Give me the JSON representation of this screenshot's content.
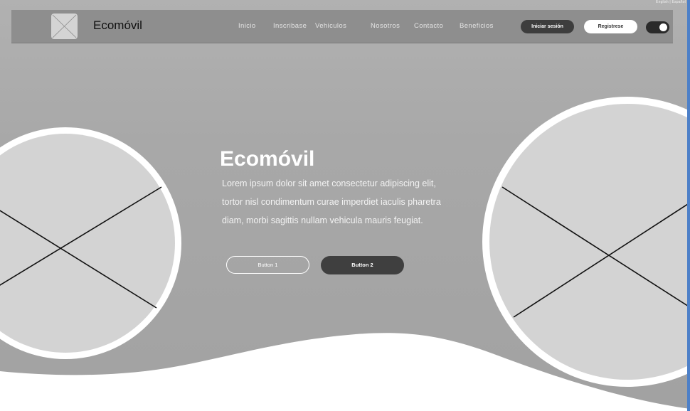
{
  "lang_switch": "English | Español",
  "navbar": {
    "brand": "Ecomóvil",
    "links": [
      "Inicio",
      "Inscribase",
      "Vehiculos",
      "Nosotros",
      "Contacto",
      "Beneficios"
    ],
    "login_label": "Iniciar sesión",
    "register_label": "Registrese"
  },
  "hero": {
    "title": "Ecomóvil",
    "text": "Lorem ipsum dolor sit amet consectetur adipiscing elit, tortor nisl condimentum curae imperdiet iaculis pharetra diam, morbi sagittis nullam vehicula mauris feugiat.",
    "button1_label": "Button 1",
    "button2_label": "Button 2"
  },
  "colors": {
    "hero_background": "#a6a6a6",
    "navbar_background": "#8e8e8e",
    "image_placeholder": "#d3d3d3",
    "dark_button": "#3d3d3d",
    "accent_edge": "#4d80c8"
  },
  "icons": {
    "logo": "image-placeholder-icon",
    "left_image": "image-placeholder-icon",
    "right_image": "image-placeholder-icon",
    "toggle": "toggle-switch-icon"
  }
}
